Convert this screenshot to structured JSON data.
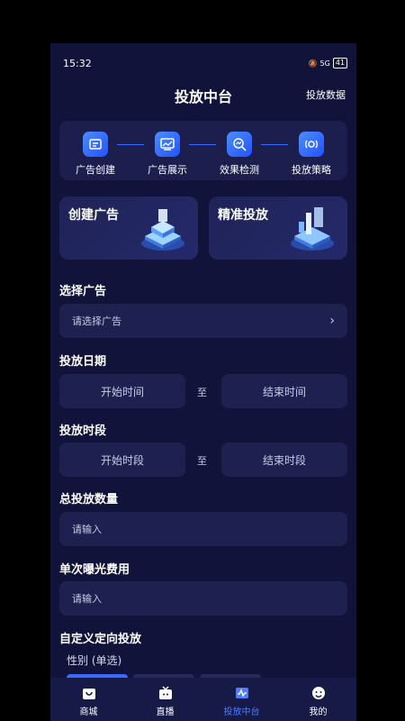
{
  "status": {
    "time": "15:32",
    "battery": "41",
    "net": "5G"
  },
  "header": {
    "title": "投放中台",
    "right_action": "投放数据"
  },
  "steps": [
    {
      "label": "广告创建",
      "icon": "ad-create-icon"
    },
    {
      "label": "广告展示",
      "icon": "ad-display-icon"
    },
    {
      "label": "效果检测",
      "icon": "effect-detect-icon"
    },
    {
      "label": "投放策略",
      "icon": "strategy-icon"
    }
  ],
  "promo": {
    "create": "创建广告",
    "precise": "精准投放"
  },
  "select_ad": {
    "label": "选择广告",
    "placeholder": "请选择广告"
  },
  "date": {
    "label": "投放日期",
    "start": "开始时间",
    "to": "至",
    "end": "结束时间"
  },
  "period": {
    "label": "投放时段",
    "start": "开始时段",
    "to": "至",
    "end": "结束时段"
  },
  "total": {
    "label": "总投放数量",
    "placeholder": "请输入"
  },
  "cost": {
    "label": "单次曝光费用",
    "placeholder": "请输入"
  },
  "custom": {
    "label": "自定义定向投放",
    "gender_label": "性别 (单选)"
  },
  "tabs": [
    {
      "label": "商城",
      "icon": "shop-bag-icon",
      "active": false
    },
    {
      "label": "直播",
      "icon": "live-tv-icon",
      "active": false
    },
    {
      "label": "投放中台",
      "icon": "dashboard-icon",
      "active": true
    },
    {
      "label": "我的",
      "icon": "profile-icon",
      "active": false
    }
  ],
  "colors": {
    "background": "#12133a",
    "card": "#1c1f4d",
    "accent": "#3a6bff"
  }
}
